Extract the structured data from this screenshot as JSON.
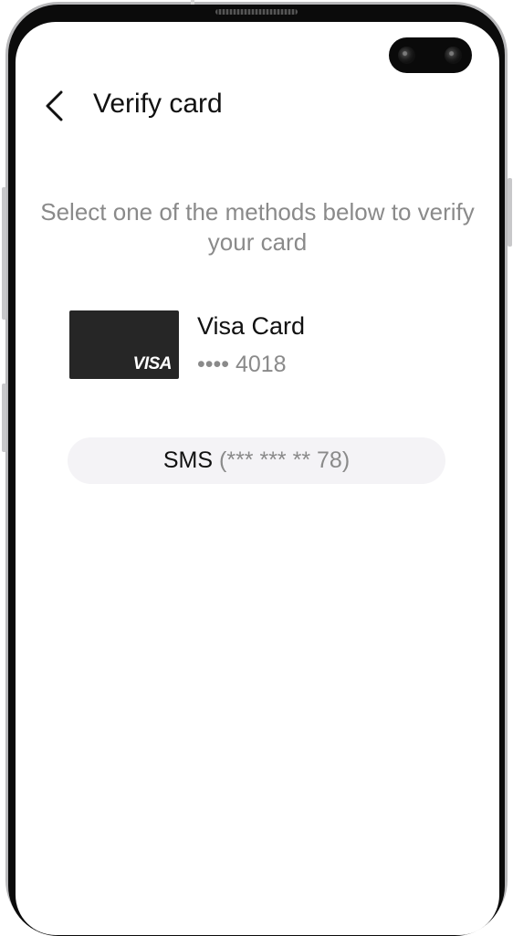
{
  "header": {
    "title": "Verify card",
    "back_icon": "chevron-left-icon"
  },
  "instructions": "Select one of the methods below to verify your card",
  "card": {
    "name": "Visa Card",
    "number": "•••• 4018",
    "brand_mark": "VISA",
    "art_color": "#262626"
  },
  "methods": [
    {
      "label": "SMS",
      "detail": "(*** *** ** 78)"
    }
  ],
  "colors": {
    "primary_text": "#111111",
    "secondary_text": "#8a8a8a",
    "button_background": "#f4f3f6"
  }
}
